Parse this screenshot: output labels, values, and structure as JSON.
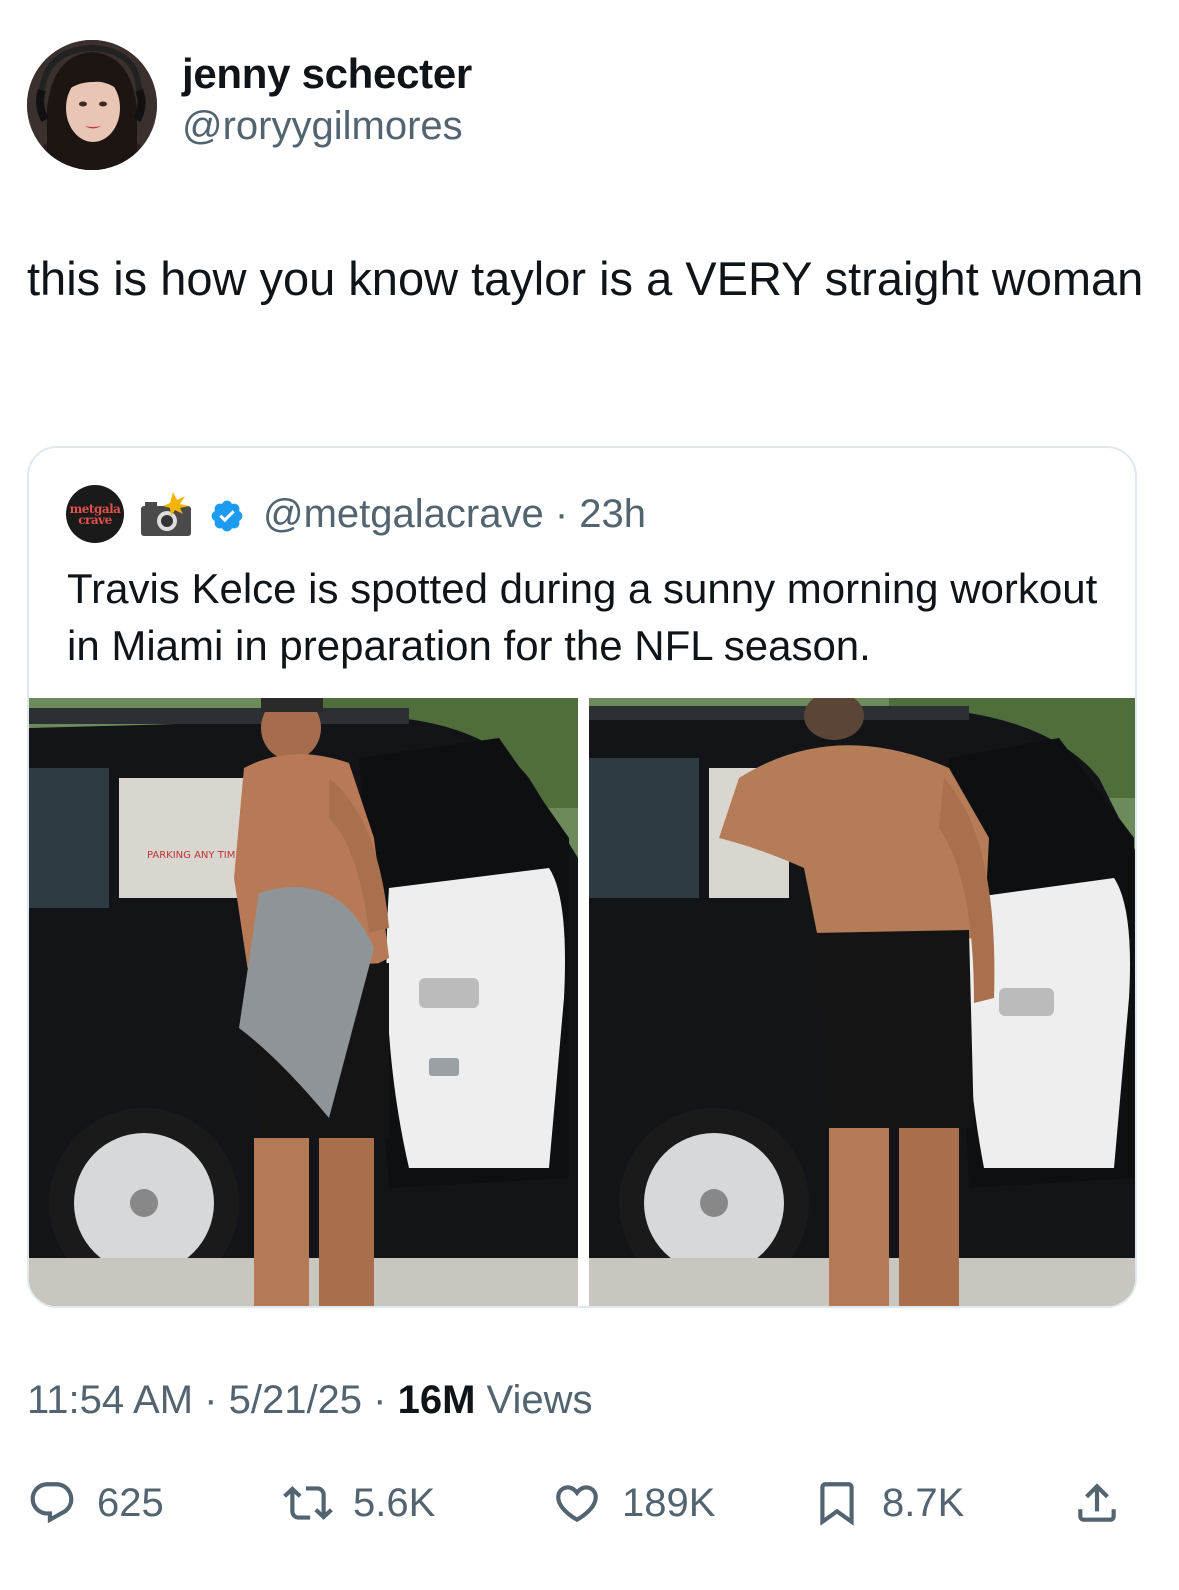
{
  "author": {
    "display_name": "jenny schecter",
    "handle": "@roryygilmores"
  },
  "tweet": {
    "text": "this is how you know taylor is a VERY straight woman"
  },
  "quote": {
    "avatar_text": "metgala crave",
    "handle": "@metgalacrave",
    "separator": " · ",
    "time": "23h",
    "text": "Travis Kelce is spotted during a sunny morning workout in Miami in preparation for the NFL season.",
    "photo_left_sign": "PARKING ANY TIME"
  },
  "meta": {
    "time": "11:54 AM",
    "sep1": " · ",
    "date": "5/21/25",
    "sep2": " · ",
    "views_count": "16M",
    "views_label": " Views"
  },
  "actions": {
    "replies": "625",
    "reposts": "5.6K",
    "likes": "189K",
    "bookmarks": "8.7K"
  },
  "colors": {
    "text_primary": "#0f1419",
    "text_secondary": "#536471",
    "verified_blue": "#1d9bf0",
    "border": "#e1e8ed"
  },
  "icons": [
    "reply-icon",
    "repost-icon",
    "like-icon",
    "bookmark-icon",
    "share-icon",
    "verified-icon",
    "camera-flash-icon"
  ]
}
